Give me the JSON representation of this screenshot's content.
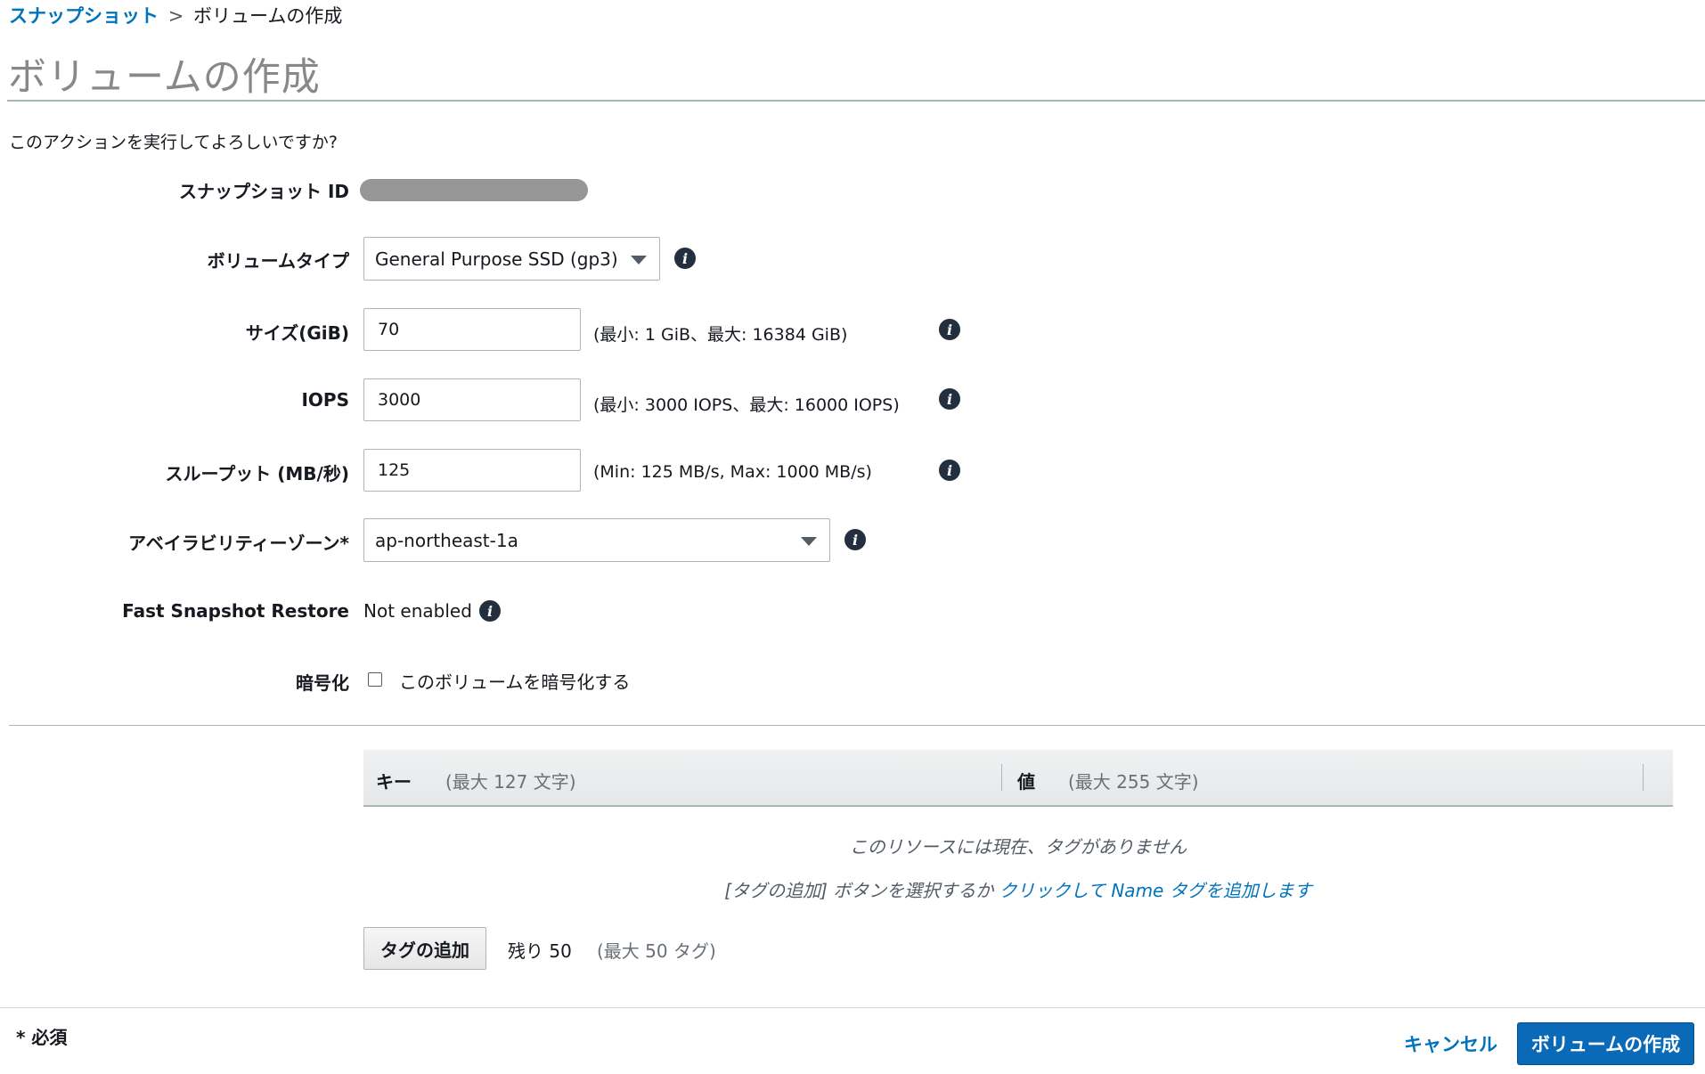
{
  "breadcrumb": {
    "parent": "スナップショット",
    "separator": ">",
    "current": "ボリュームの作成"
  },
  "page_title": "ボリュームの作成",
  "confirm_text": "このアクションを実行してよろしいですか?",
  "fields": {
    "snapshot_id": {
      "label": "スナップショット ID"
    },
    "volume_type": {
      "label": "ボリュームタイプ",
      "value": "General Purpose SSD (gp3)"
    },
    "size": {
      "label": "サイズ(GiB)",
      "value": "70",
      "hint": "(最小: 1 GiB、最大: 16384 GiB)"
    },
    "iops": {
      "label": "IOPS",
      "value": "3000",
      "hint": "(最小: 3000 IOPS、最大: 16000 IOPS)"
    },
    "throughput": {
      "label": "スループット (MB/秒)",
      "value": "125",
      "hint": "(Min: 125 MB/s, Max: 1000 MB/s)"
    },
    "availability_zone": {
      "label": "アベイラビリティーゾーン*",
      "value": "ap-northeast-1a"
    },
    "fast_snapshot_restore": {
      "label": "Fast Snapshot Restore",
      "value": "Not enabled"
    },
    "encryption": {
      "label": "暗号化",
      "checkbox_label": "このボリュームを暗号化する",
      "checked": false
    }
  },
  "tags": {
    "key_header": "キー",
    "key_hint": "(最大 127 文字)",
    "value_header": "値",
    "value_hint": "(最大 255 文字)",
    "empty_message": "このリソースには現在、タグがありません",
    "help_prefix": "[タグの追加] ボタンを選択するか",
    "help_link": "クリックして Name タグを追加します",
    "add_button": "タグの追加",
    "remaining": "残り 50",
    "max": "(最大 50 タグ)"
  },
  "footer": {
    "required": "* 必須",
    "cancel": "キャンセル",
    "submit": "ボリュームの作成"
  }
}
